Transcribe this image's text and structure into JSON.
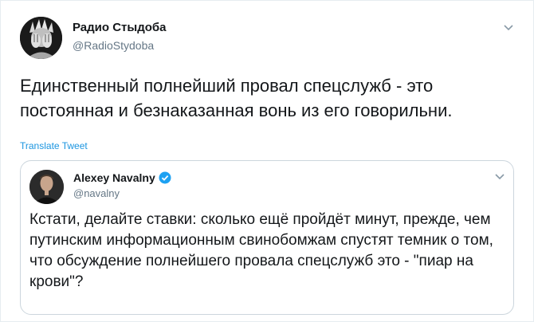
{
  "tweet": {
    "author_name": "Радио Стыдоба",
    "author_handle": "@RadioStydoba",
    "text": "Единственный полнейший провал спецслужб - это постоянная и безнаказанная вонь из его говорильни.",
    "translate_label": "Translate Tweet",
    "avatar_icon": "statue-of-liberty-facepalm-avatar",
    "menu_icon": "chevron-down-icon"
  },
  "quoted_tweet": {
    "author_name": "Alexey Navalny",
    "verified": true,
    "author_handle": "@navalny",
    "text": "Кстати, делайте ставки: сколько ещё пройдёт минут, прежде, чем путинским информационным свинобомжам спустят темник о том, что обсуждение полнейшего провала спецслужб это - \"пиар на крови\"?",
    "avatar_icon": "portrait-avatar",
    "menu_icon": "chevron-down-icon"
  },
  "colors": {
    "link": "#1b95e0",
    "verified_badge": "#1da1f2",
    "secondary_text": "#657786",
    "border": "#ccd6dd"
  }
}
